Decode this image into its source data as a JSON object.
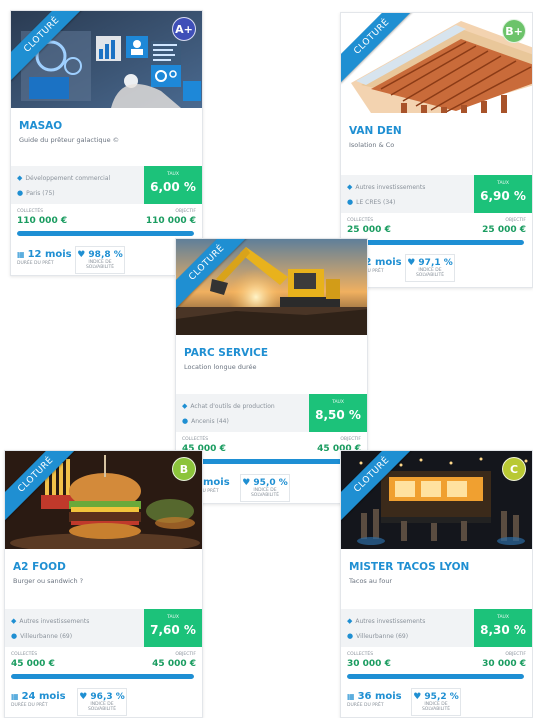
{
  "cards": [
    {
      "id": "masao",
      "status": "CLOTURÉ",
      "grade": "A+",
      "grade_color": "#3f4fb8",
      "title": "MASAO",
      "subtitle": "Guide du prêteur galactique ©",
      "sector": "Développement commercial",
      "location": "Paris (75)",
      "rate_label": "TAUX",
      "rate": "6,00 %",
      "collected_label": "COLLECTÉS",
      "collected": "110 000 €",
      "target_label": "OBJECTIF",
      "target": "110 000 €",
      "progress": 1.0,
      "duration": "12 mois",
      "duration_label": "DURÉE DU PRÊT",
      "score": "98,8 %",
      "score_label_1": "INDICE DE",
      "score_label_2": "SOLVABILITÉ"
    },
    {
      "id": "van-den",
      "status": "CLOTURÉ",
      "grade": "B+",
      "grade_color": "#6cc36a",
      "title": "VAN DEN",
      "subtitle": "Isolation & Co",
      "sector": "Autres investissements",
      "location": "LE CRES (34)",
      "rate_label": "TAUX",
      "rate": "6,90 %",
      "collected_label": "COLLECTÉS",
      "collected": "25 000 €",
      "target_label": "OBJECTIF",
      "target": "25 000 €",
      "progress": 1.0,
      "duration": "12 mois",
      "duration_label": "DURÉE DU PRÊT",
      "score": "97,1 %",
      "score_label_1": "INDICE DE",
      "score_label_2": "SOLVABILITÉ"
    },
    {
      "id": "parc-service",
      "status": "CLOTURÉ",
      "grade": "",
      "grade_color": "",
      "title": "PARC SERVICE",
      "subtitle": "Location longue durée",
      "sector": "Achat d'outils de production",
      "location": "Ancenis (44)",
      "rate_label": "TAUX",
      "rate": "8,50 %",
      "collected_label": "COLLECTÉS",
      "collected": "45 000 €",
      "target_label": "OBJECTIF",
      "target": "45 000 €",
      "progress": 1.0,
      "duration": "6 mois",
      "duration_label": "DURÉE DU PRÊT",
      "score": "95,0 %",
      "score_label_1": "INDICE DE",
      "score_label_2": "SOLVABILITÉ"
    },
    {
      "id": "a2-food",
      "status": "CLOTURÉ",
      "grade": "B",
      "grade_color": "#8cc43c",
      "title": "A2 FOOD",
      "subtitle": "Burger ou sandwich ?",
      "sector": "Autres investissements",
      "location": "Villeurbanne (69)",
      "rate_label": "TAUX",
      "rate": "7,60 %",
      "collected_label": "COLLECTÉS",
      "collected": "45 000 €",
      "target_label": "OBJECTIF",
      "target": "45 000 €",
      "progress": 1.0,
      "duration": "24 mois",
      "duration_label": "DURÉE DU PRÊT",
      "score": "96,3 %",
      "score_label_1": "INDICE DE",
      "score_label_2": "SOLVABILITÉ"
    },
    {
      "id": "mister-tacos-lyon",
      "status": "CLOTURÉ",
      "grade": "C",
      "grade_color": "#b9c934",
      "title": "MISTER TACOS LYON",
      "subtitle": "Tacos au four",
      "sector": "Autres investissements",
      "location": "Villeurbanne (69)",
      "rate_label": "TAUX",
      "rate": "8,30 %",
      "collected_label": "COLLECTÉS",
      "collected": "30 000 €",
      "target_label": "OBJECTIF",
      "target": "30 000 €",
      "progress": 1.0,
      "duration": "36 mois",
      "duration_label": "DURÉE DU PRÊT",
      "score": "95,2 %",
      "score_label_1": "INDICE DE",
      "score_label_2": "SOLVABILITÉ"
    }
  ],
  "colors": {
    "ribbon": "#1f8fd2",
    "title": "#1f8fd2",
    "rate_box": "#1cc27a",
    "amount": "#1a9c60",
    "progress": "#1e8fd4"
  },
  "icons": {
    "sector": "tag-icon",
    "location": "map-pin-icon",
    "duration": "calendar-icon",
    "score": "shield-heart-icon"
  }
}
